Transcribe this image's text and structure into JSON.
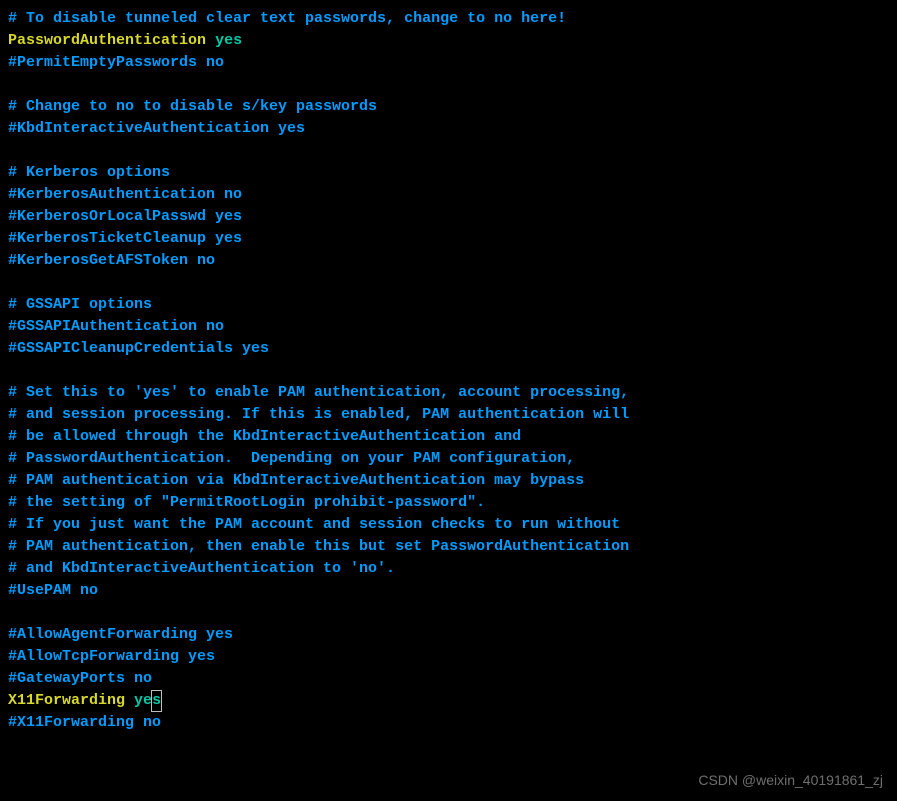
{
  "lines": [
    {
      "type": "comment",
      "text": "# To disable tunneled clear text passwords, change to no here!"
    },
    {
      "type": "config",
      "key": "PasswordAuthentication",
      "value": "yes"
    },
    {
      "type": "comment",
      "text": "#PermitEmptyPasswords no"
    },
    {
      "type": "blank"
    },
    {
      "type": "comment",
      "text": "# Change to no to disable s/key passwords"
    },
    {
      "type": "comment",
      "text": "#KbdInteractiveAuthentication yes"
    },
    {
      "type": "blank"
    },
    {
      "type": "comment",
      "text": "# Kerberos options"
    },
    {
      "type": "comment",
      "text": "#KerberosAuthentication no"
    },
    {
      "type": "comment",
      "text": "#KerberosOrLocalPasswd yes"
    },
    {
      "type": "comment",
      "text": "#KerberosTicketCleanup yes"
    },
    {
      "type": "comment",
      "text": "#KerberosGetAFSToken no"
    },
    {
      "type": "blank"
    },
    {
      "type": "comment",
      "text": "# GSSAPI options"
    },
    {
      "type": "comment",
      "text": "#GSSAPIAuthentication no"
    },
    {
      "type": "comment",
      "text": "#GSSAPICleanupCredentials yes"
    },
    {
      "type": "blank"
    },
    {
      "type": "comment",
      "text": "# Set this to 'yes' to enable PAM authentication, account processing,"
    },
    {
      "type": "comment",
      "text": "# and session processing. If this is enabled, PAM authentication will"
    },
    {
      "type": "comment",
      "text": "# be allowed through the KbdInteractiveAuthentication and"
    },
    {
      "type": "comment",
      "text": "# PasswordAuthentication.  Depending on your PAM configuration,"
    },
    {
      "type": "comment",
      "text": "# PAM authentication via KbdInteractiveAuthentication may bypass"
    },
    {
      "type": "comment",
      "text": "# the setting of \"PermitRootLogin prohibit-password\"."
    },
    {
      "type": "comment",
      "text": "# If you just want the PAM account and session checks to run without"
    },
    {
      "type": "comment",
      "text": "# PAM authentication, then enable this but set PasswordAuthentication"
    },
    {
      "type": "comment",
      "text": "# and KbdInteractiveAuthentication to 'no'."
    },
    {
      "type": "comment",
      "text": "#UsePAM no"
    },
    {
      "type": "blank"
    },
    {
      "type": "comment",
      "text": "#AllowAgentForwarding yes"
    },
    {
      "type": "comment",
      "text": "#AllowTcpForwarding yes"
    },
    {
      "type": "comment",
      "text": "#GatewayPorts no"
    },
    {
      "type": "config_cursor",
      "key": "X11Forwarding",
      "value_pre": "ye",
      "value_cursor": "s"
    },
    {
      "type": "comment",
      "text": "#X11Forwarding no"
    }
  ],
  "watermark": "CSDN @weixin_40191861_zj"
}
